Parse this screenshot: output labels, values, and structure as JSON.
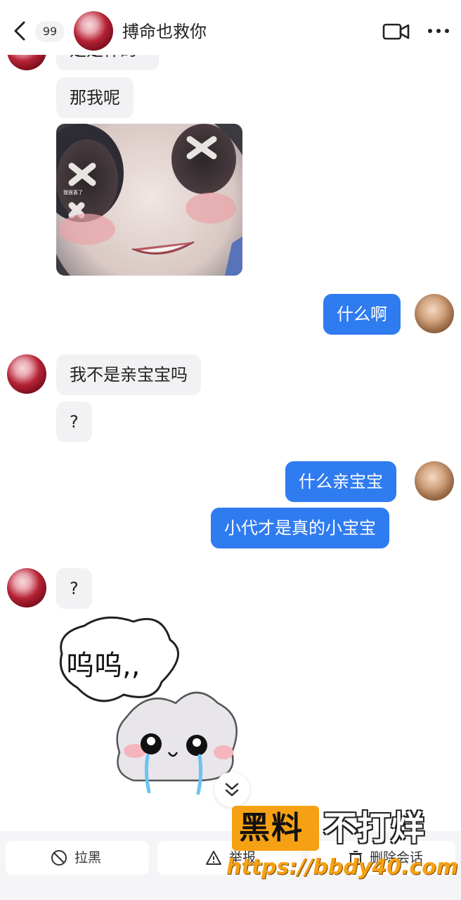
{
  "header": {
    "unread_badge": "99",
    "contact_name": "搏命也救你"
  },
  "messages": [
    {
      "id": "m0",
      "side": "in",
      "text": "是是什的"
    },
    {
      "id": "m1",
      "side": "in",
      "text": "那我呢"
    },
    {
      "id": "m2",
      "side": "in",
      "type": "image",
      "overlay_text": "我很喜了"
    },
    {
      "id": "m3",
      "side": "out",
      "text": "什么啊"
    },
    {
      "id": "m4",
      "side": "in",
      "text": "我不是亲宝宝吗"
    },
    {
      "id": "m5",
      "side": "in",
      "text": "?"
    },
    {
      "id": "m6",
      "side": "out",
      "text": "什么亲宝宝"
    },
    {
      "id": "m7",
      "side": "out",
      "text": "小代才是真的小宝宝"
    },
    {
      "id": "m8",
      "side": "in",
      "text": "?"
    },
    {
      "id": "m9",
      "side": "in",
      "type": "sticker",
      "sticker_text": "呜呜,,"
    }
  ],
  "bottom_actions": {
    "block_label": "拉黑",
    "report_label": "举报",
    "delete_label": "删除会话"
  },
  "watermark": {
    "box_text": "黑料",
    "right_text": "不打烊",
    "url": "https://bbdy40.com"
  },
  "icons": [
    "back-chevron-icon",
    "video-call-icon",
    "more-dots-icon",
    "block-icon",
    "warning-icon",
    "trash-icon",
    "scroll-down-chevron-icon"
  ],
  "colors": {
    "outgoing_bubble": "#2f7bf0",
    "incoming_bubble": "#f2f2f4",
    "watermark_orange": "#f6a114"
  }
}
